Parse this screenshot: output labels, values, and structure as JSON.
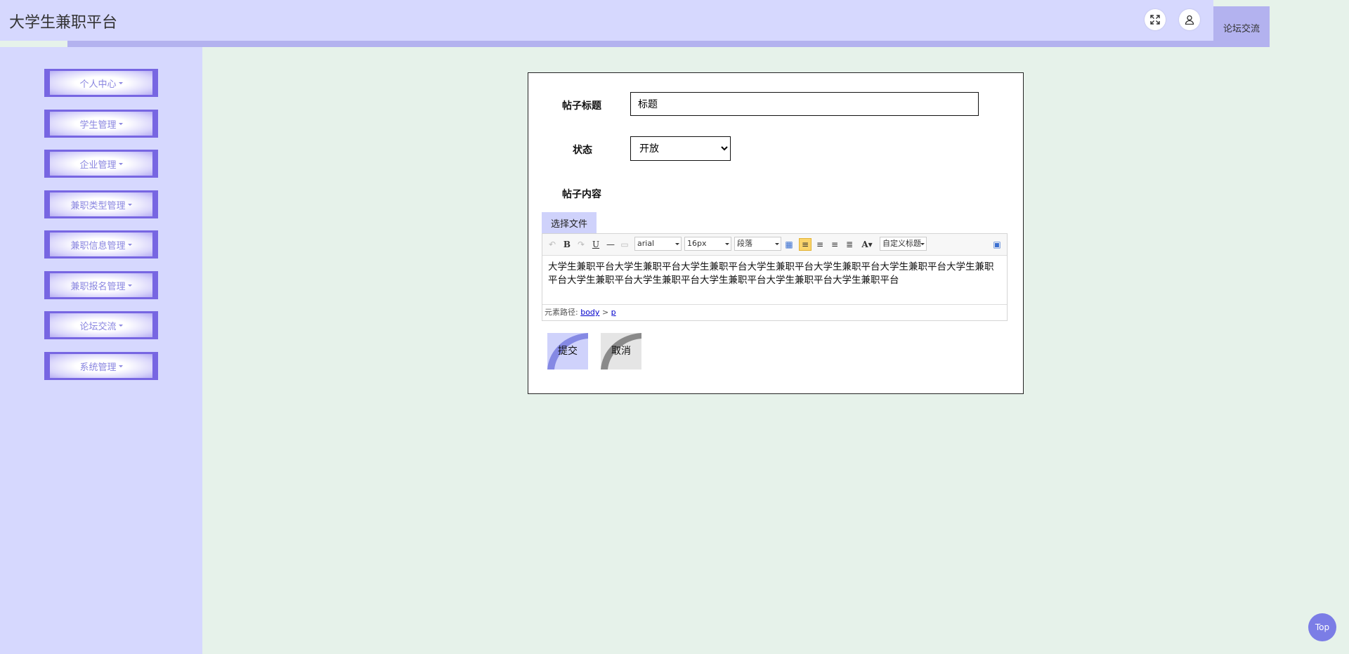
{
  "header": {
    "title": "大学生兼职平台",
    "tab_label": "论坛交流",
    "fullscreen_icon": "expand-icon",
    "user_icon": "user-icon"
  },
  "sidebar": {
    "items": [
      {
        "label": "个人中心"
      },
      {
        "label": "学生管理"
      },
      {
        "label": "企业管理"
      },
      {
        "label": "兼职类型管理"
      },
      {
        "label": "兼职信息管理"
      },
      {
        "label": "兼职报名管理"
      },
      {
        "label": "论坛交流"
      },
      {
        "label": "系统管理"
      }
    ]
  },
  "form": {
    "title_label": "帖子标题",
    "title_value": "标题",
    "status_label": "状态",
    "status_value": "开放",
    "content_label": "帖子内容",
    "file_button": "选择文件",
    "editor": {
      "font": "arial",
      "size": "16px",
      "paragraph": "段落",
      "custom_title": "自定义标题",
      "content": "大学生兼职平台大学生兼职平台大学生兼职平台大学生兼职平台大学生兼职平台大学生兼职平台大学生兼职平台大学生兼职平台大学生兼职平台大学生兼职平台大学生兼职平台大学生兼职平台",
      "path_label": "元素路径:",
      "path_body": "body",
      "path_sep": ">",
      "path_p": "p"
    },
    "submit_label": "提交",
    "cancel_label": "取消"
  },
  "top_button": "Top",
  "colors": {
    "header_bg": "#d6d8fe",
    "accent": "#7766e2",
    "page_bg": "#e6f2ea"
  }
}
